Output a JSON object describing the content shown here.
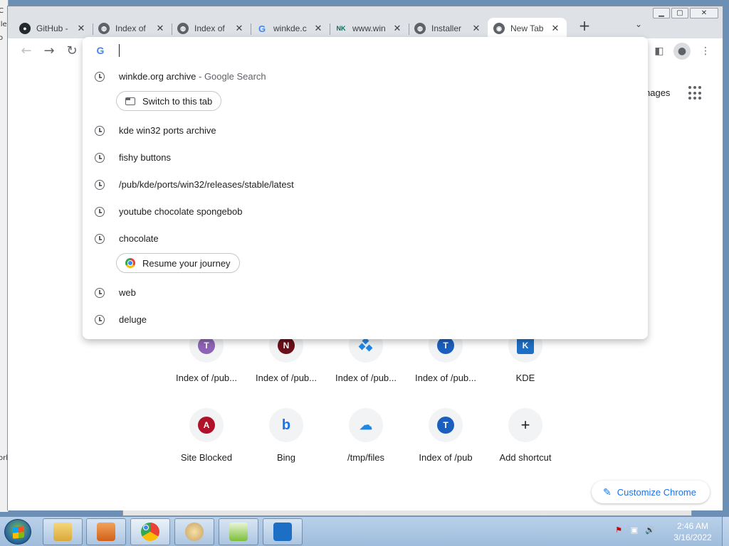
{
  "background": {
    "left_strip_text": [
      "C",
      "ile",
      "o",
      "",
      "orl"
    ]
  },
  "browser": {
    "tabs": [
      {
        "title": "GitHub -",
        "icon": "github-icon"
      },
      {
        "title": "Index of",
        "icon": "globe-icon"
      },
      {
        "title": "Index of",
        "icon": "globe-icon"
      },
      {
        "title": "winkde.c",
        "icon": "google-icon"
      },
      {
        "title": "www.win",
        "icon": "nk-icon",
        "favicon_text": "NK"
      },
      {
        "title": "Installer",
        "icon": "globe-icon"
      },
      {
        "title": "New Tab",
        "icon": "chrome-icon",
        "active": true
      }
    ],
    "new_tab_symbol": "+",
    "tab_search_symbol": "⌄",
    "window_controls": {
      "minimize": "▁",
      "maximize": "▢",
      "close": "✕"
    }
  },
  "omnibox": {
    "input_value": "",
    "search_engine_icon": "G",
    "suggestions": [
      {
        "text": "winkde.org archive",
        "suffix": " - Google Search",
        "chip": {
          "label": "Switch to this tab",
          "icon": "tab-icon"
        }
      },
      {
        "text": "kde win32 ports archive"
      },
      {
        "text": "fishy buttons"
      },
      {
        "text": "/pub/kde/ports/win32/releases/stable/latest"
      },
      {
        "text": "youtube chocolate spongebob"
      },
      {
        "text": "chocolate",
        "chip": {
          "label": "Resume your journey",
          "icon": "chrome-icon"
        }
      },
      {
        "text": "web"
      },
      {
        "text": "deluge"
      }
    ]
  },
  "ntp": {
    "images_label": "nages",
    "shortcuts": [
      {
        "label": "Index of /pub...",
        "letter": "T",
        "color": "#8e63b6"
      },
      {
        "label": "Index of /pub...",
        "letter": "N",
        "color": "#6b0f1a"
      },
      {
        "label": "Index of /pub...",
        "letter": "",
        "color": "#1e88e5"
      },
      {
        "label": "Index of /pub...",
        "letter": "T",
        "color": "#1a5fbf"
      },
      {
        "label": "KDE",
        "letter": "K",
        "color": "#1d6fc5"
      },
      {
        "label": "Site Blocked",
        "letter": "A",
        "color": "#b0112b"
      },
      {
        "label": "Bing",
        "letter": "b",
        "color": "#1a73e8"
      },
      {
        "label": "/tmp/files",
        "letter": "☁",
        "color": "#1e88e5"
      },
      {
        "label": "Index of /pub",
        "letter": "T",
        "color": "#1a5fbf"
      },
      {
        "label": "Add shortcut",
        "letter": "+",
        "color": "#202124"
      }
    ],
    "customize_label": "Customize Chrome"
  },
  "taskbar": {
    "time": "2:46 AM",
    "date": "3/16/2022",
    "apps": [
      {
        "name": "explorer",
        "color": "#e8c25a"
      },
      {
        "name": "media",
        "color": "#e87a2a"
      },
      {
        "name": "chrome",
        "color": "#db4437"
      },
      {
        "name": "paint",
        "color": "#6aa0d8"
      },
      {
        "name": "notepad",
        "color": "#7cbf3b"
      },
      {
        "name": "kde",
        "color": "#1d6fc5"
      }
    ]
  }
}
